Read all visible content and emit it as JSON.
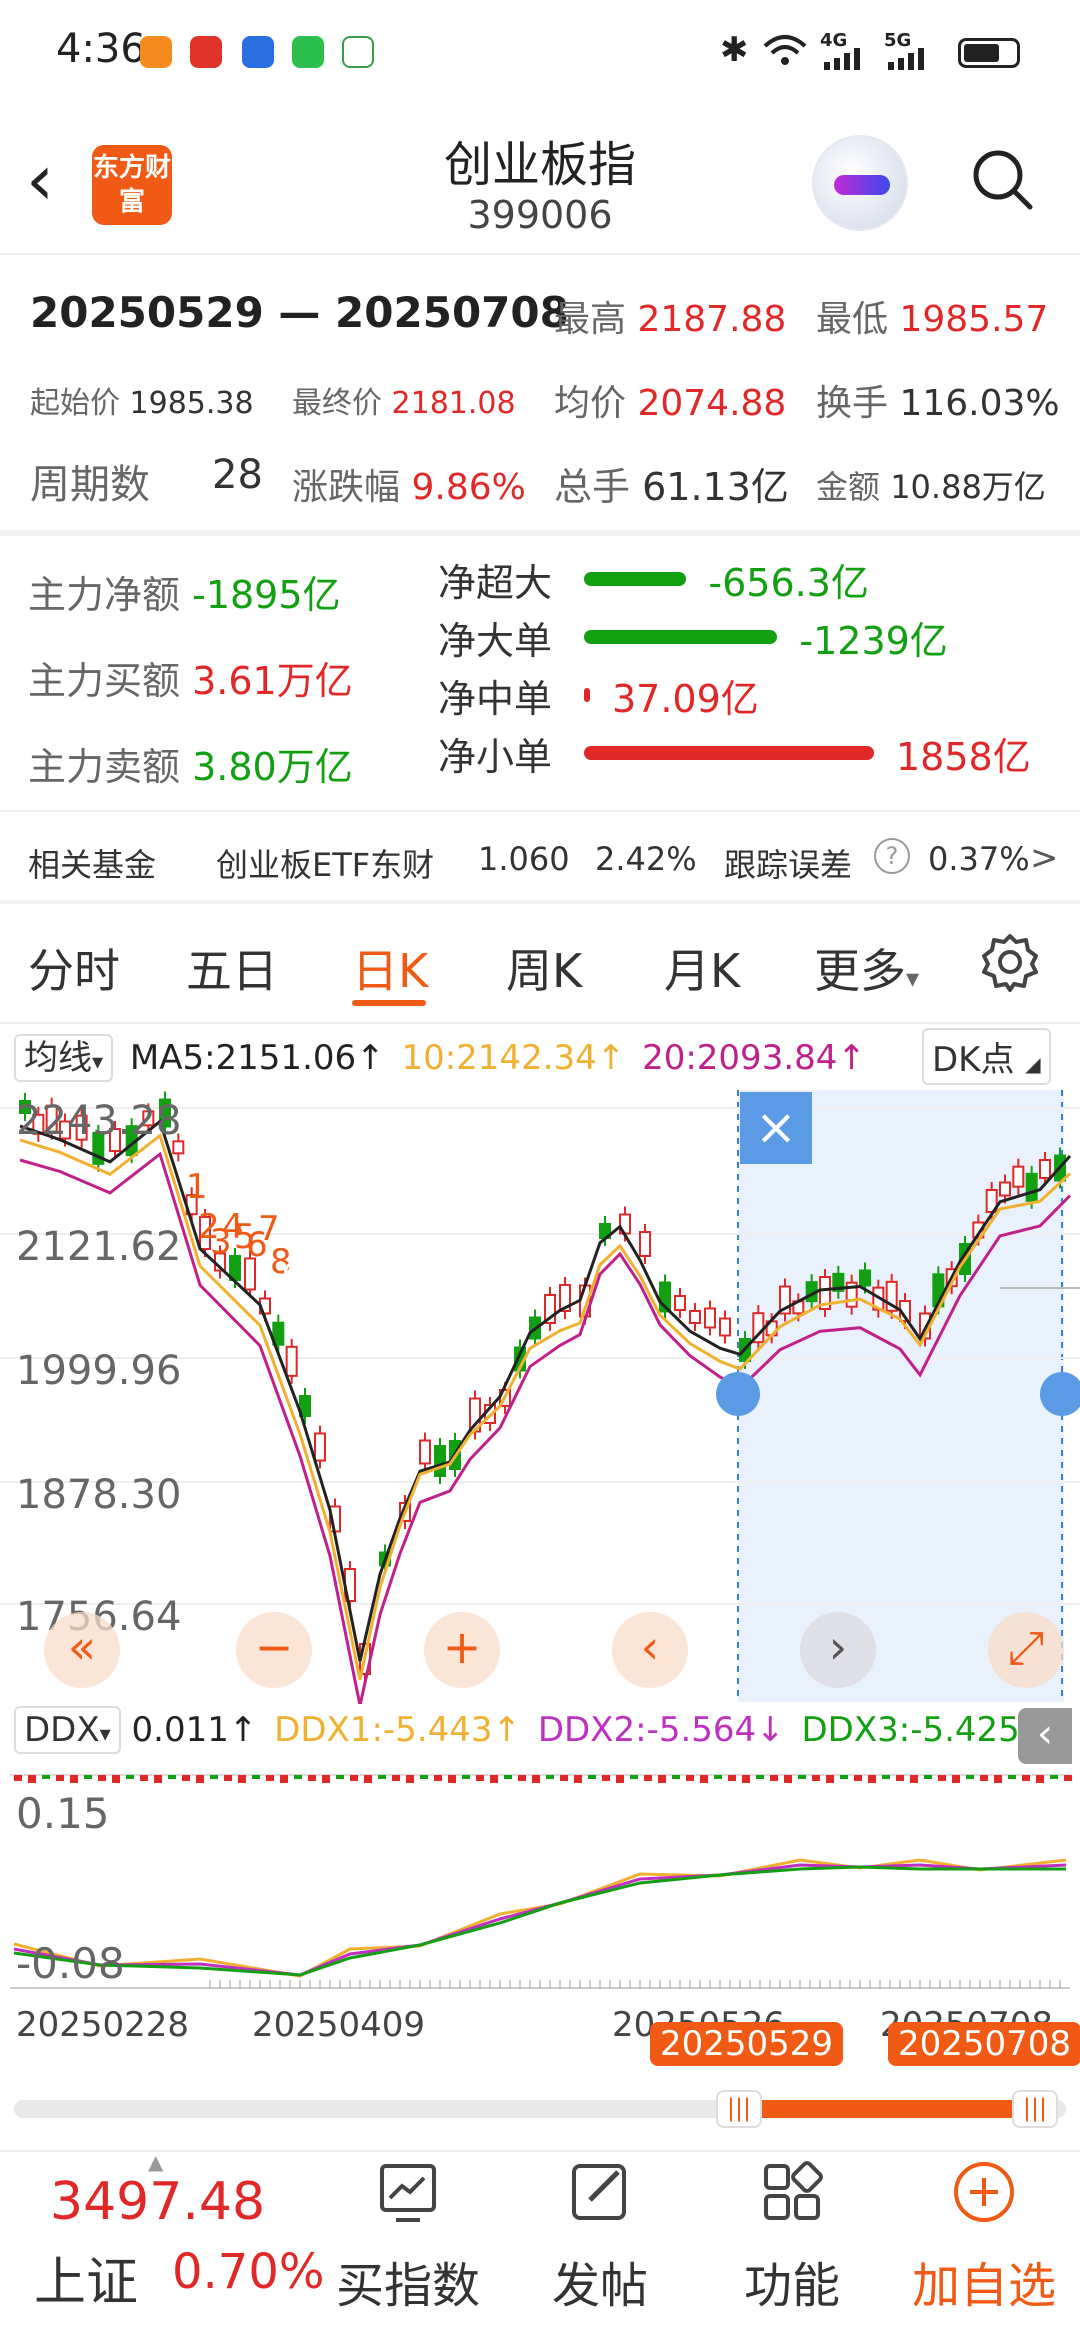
{
  "status_bar": {
    "time": "4:36",
    "network_4g": "4G",
    "network_5g": "5G"
  },
  "nav": {
    "title": "创业板指",
    "code": "399006",
    "logo_text": "东方财富"
  },
  "range": {
    "start": "20250529",
    "dash": "—",
    "end": "20250708"
  },
  "stats": {
    "high_label": "最高",
    "high": "2187.88",
    "low_label": "最低",
    "low": "1985.57",
    "open_label": "起始价",
    "open": "1985.38",
    "close_label": "最终价",
    "close": "2181.08",
    "avg_label": "均价",
    "avg": "2074.88",
    "turnover_label": "换手",
    "turnover": "116.03%",
    "periods_label": "周期数",
    "periods": "28",
    "change_label": "涨跌幅",
    "change": "9.86%",
    "volume_label": "总手",
    "volume": "61.13亿",
    "amount_label": "金额",
    "amount": "10.88万亿"
  },
  "flow": {
    "net_label": "主力净额",
    "net": "-1895亿",
    "buy_label": "主力买额",
    "buy": "3.61万亿",
    "sell_label": "主力卖额",
    "sell": "3.80万亿",
    "bars": [
      {
        "label": "净超大",
        "value": "-656.3亿",
        "magnitude": 656.3,
        "color": "#12a012"
      },
      {
        "label": "净大单",
        "value": "-1239亿",
        "magnitude": 1239,
        "color": "#12a012"
      },
      {
        "label": "净中单",
        "value": "37.09亿",
        "magnitude": 37.09,
        "color": "#e02828"
      },
      {
        "label": "净小单",
        "value": "1858亿",
        "magnitude": 1858,
        "color": "#e02828"
      }
    ]
  },
  "fund": {
    "label": "相关基金",
    "name": "创业板ETF东财",
    "price": "1.060",
    "change": "2.42%",
    "track_label": "跟踪误差",
    "help": "?",
    "track": "0.37%",
    "arrow": ">"
  },
  "tabs": [
    "分时",
    "五日",
    "日K",
    "周K",
    "月K",
    "更多"
  ],
  "active_tab": "日K",
  "tab_more_arrow": "▾",
  "legend": {
    "ma_selector": "均线",
    "selector_arrow": "▾",
    "ma5": "MA5:2151.06↑",
    "ma10": "10:2142.34↑",
    "ma20": "20:2093.84↑",
    "dk": "DK点"
  },
  "colors": {
    "up": "#e02828",
    "down": "#12a012",
    "ma5": "#222222",
    "ma10": "#f0b030",
    "ma20": "#c0208a",
    "accent": "#f05a14"
  },
  "price_axis": [
    "2243.28",
    "2121.62",
    "1999.96",
    "1878.30",
    "1756.64"
  ],
  "close_icon": "×",
  "controls": [
    "«",
    "−",
    "+",
    "‹",
    "›",
    "⤢"
  ],
  "ddx_legend": {
    "selector": "DDX",
    "selector_arrow": "▾",
    "ddx": "0.011↑",
    "ddx1": "DDX1:-5.443↑",
    "ddx2": "DDX2:-5.564↓",
    "ddx3": "DDX3:-5.425↓",
    "collapse_icon": "‹"
  },
  "ddx_axis": [
    "0.15",
    "-0.08"
  ],
  "date_axis": [
    "20250228",
    "20250409",
    "20250526",
    "20250708"
  ],
  "range_tags": [
    "20250529",
    "20250708"
  ],
  "td_marks_left": [
    "1",
    "2",
    "3",
    "4",
    "5",
    "6",
    "7",
    "8",
    "9"
  ],
  "bottom": {
    "index_value": "3497.48",
    "index_name": "上证",
    "index_change": "0.70%",
    "buttons": [
      "买指数",
      "发帖",
      "功能",
      "加自选"
    ],
    "add_icon": "+"
  }
}
